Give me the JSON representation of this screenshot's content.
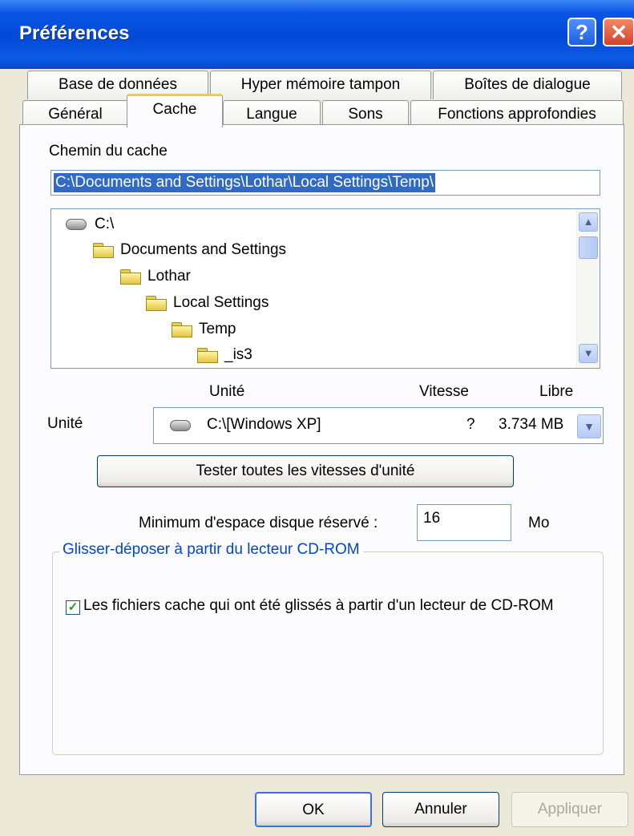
{
  "window": {
    "title": "Préférences",
    "help_label": "?",
    "close_label": "✕"
  },
  "tabs": {
    "row1": [
      "Base de données",
      "Hyper mémoire tampon",
      "Boîtes de dialogue"
    ],
    "row2": [
      "Général",
      "Cache",
      "Langue",
      "Sons",
      "Fonctions approfondies"
    ],
    "active": "Cache"
  },
  "cache": {
    "path_label": "Chemin du cache",
    "path_value": "C:\\Documents and Settings\\Lothar\\Local Settings\\Temp\\",
    "tree": [
      {
        "label": "C:\\",
        "icon": "drive-icon"
      },
      {
        "label": "Documents and Settings",
        "icon": "folder-icon"
      },
      {
        "label": "Lothar",
        "icon": "folder-icon"
      },
      {
        "label": "Local Settings",
        "icon": "folder-icon"
      },
      {
        "label": "Temp",
        "icon": "folder-icon"
      },
      {
        "label": "_is3",
        "icon": "folder-icon"
      }
    ],
    "drive_headers": {
      "unit": "Unité",
      "speed": "Vitesse",
      "free": "Libre"
    },
    "drive_label": "Unité",
    "drive_selected": {
      "name": "C:\\[Windows XP]",
      "speed": "?",
      "free": "3.734 MB"
    },
    "test_button": "Tester toutes les vitesses d'unité",
    "min_space_label": "Minimum d'espace disque réservé :",
    "min_space_value": "16",
    "min_space_unit": "Mo",
    "cdrom_group_title": "Glisser-déposer à partir du lecteur CD-ROM",
    "cdrom_checkbox_label": "Les fichiers cache qui ont été glissés à partir d'un lecteur de CD-ROM",
    "cdrom_checked": true
  },
  "buttons": {
    "ok": "OK",
    "cancel": "Annuler",
    "apply": "Appliquer"
  },
  "colors": {
    "titlebar": "#0149d6",
    "selection": "#316ac5",
    "group_title": "#0046d5",
    "active_tab_accent": "#ffc73c"
  }
}
